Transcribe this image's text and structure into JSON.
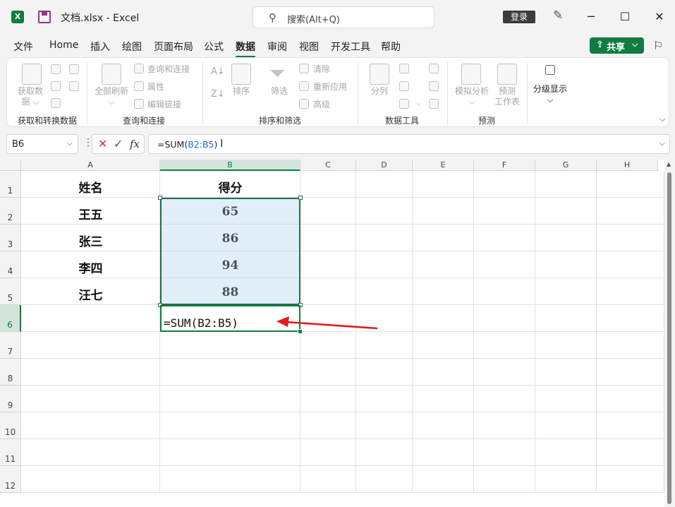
{
  "titlebar": {
    "app_icon": "X",
    "doc_title": "文档.xlsx  -  Excel",
    "search_placeholder": "搜索(Alt+Q)",
    "login": "登录",
    "minimize": "─",
    "maximize": "☐",
    "close": "✕"
  },
  "menu": {
    "items": [
      "文件",
      "Home",
      "插入",
      "绘图",
      "页面布局",
      "公式",
      "数据",
      "审阅",
      "视图",
      "开发工具",
      "帮助"
    ],
    "active_index": 6,
    "share": "共享"
  },
  "ribbon": {
    "groups": {
      "get_data": "获取和转换数据",
      "query": "查询和连接",
      "sort_filter": "排序和筛选",
      "data_tools": "数据工具",
      "forecast": "预测"
    },
    "buttons": {
      "get_data_l1": "获取数",
      "get_data_l2": "据",
      "refresh_all": "全部刷新",
      "query_conn": "查询和连接",
      "properties": "属性",
      "edit_links": "编辑链接",
      "sort": "排序",
      "filter": "筛选",
      "clear": "清除",
      "reapply": "重新应用",
      "advanced": "高级",
      "split": "分列",
      "what_if": "模拟分析",
      "forecast_l1": "预测",
      "forecast_l2": "工作表",
      "outline": "分级显示"
    },
    "colors": {
      "accent": "#107c41",
      "disabled_text": "#a6a6a6"
    }
  },
  "formula_bar": {
    "name_box": "B6",
    "formula_prefix": "=SUM(",
    "formula_ref": "B2:B5",
    "formula_suffix": ")",
    "fx": "fx"
  },
  "sheet": {
    "columns": [
      "A",
      "B",
      "C",
      "D",
      "E",
      "F",
      "G",
      "H"
    ],
    "selected_column": "B",
    "rows": [
      "1",
      "2",
      "3",
      "4",
      "5",
      "6",
      "7",
      "8",
      "9",
      "10",
      "11",
      "12"
    ],
    "selected_row": "6",
    "cells": {
      "A1": "姓名",
      "B1": "得分",
      "A2": "王五",
      "B2": "65",
      "A3": "张三",
      "B3": "86",
      "A4": "李四",
      "B4": "94",
      "A5": "汪七",
      "B5": "88",
      "B6": "=SUM(B2:B5)"
    },
    "arrow_color": "#e01b1b"
  }
}
